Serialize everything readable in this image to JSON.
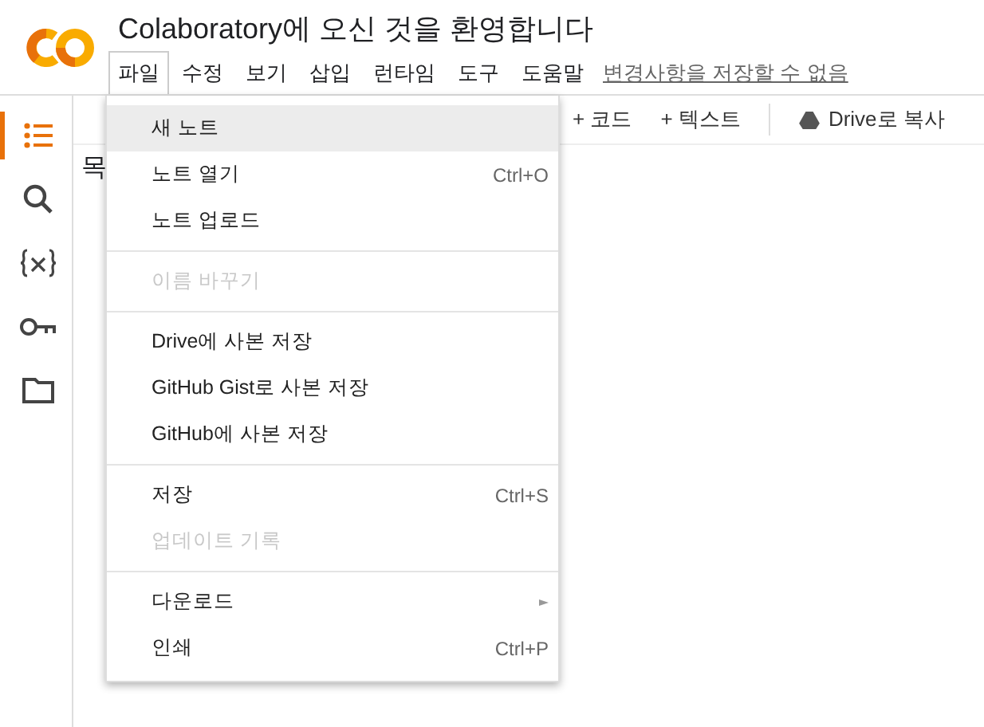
{
  "header": {
    "title": "Colaboratory에 오신 것을 환영합니다",
    "status_link": "변경사항을 저장할 수 없음"
  },
  "menubar": [
    {
      "label": "파일",
      "selected": true
    },
    {
      "label": "수정",
      "selected": false
    },
    {
      "label": "보기",
      "selected": false
    },
    {
      "label": "삽입",
      "selected": false
    },
    {
      "label": "런타임",
      "selected": false
    },
    {
      "label": "도구",
      "selected": false
    },
    {
      "label": "도움말",
      "selected": false
    }
  ],
  "sidebar": {
    "items": [
      {
        "kind": "toc",
        "selected": true
      },
      {
        "kind": "search",
        "selected": false
      },
      {
        "kind": "variables",
        "selected": false
      },
      {
        "kind": "secrets",
        "selected": false
      },
      {
        "kind": "files",
        "selected": false
      }
    ],
    "panel_title": "목"
  },
  "toolbar": {
    "add_code": "+ 코드",
    "add_text": "+ 텍스트",
    "copy_to_drive": "Drive로 복사"
  },
  "file_menu": {
    "sections": [
      [
        {
          "label": "새 노트",
          "disabled": false,
          "selected": true,
          "submenu": false
        },
        {
          "label": "노트 열기",
          "shortcut": "Ctrl+O",
          "disabled": false,
          "selected": false,
          "submenu": false
        },
        {
          "label": "노트 업로드",
          "disabled": false,
          "selected": false,
          "submenu": false
        }
      ],
      [
        {
          "label": "이름 바꾸기",
          "disabled": true,
          "selected": false,
          "submenu": false
        }
      ],
      [
        {
          "label": "Drive에 사본 저장",
          "disabled": false,
          "selected": false,
          "submenu": false
        },
        {
          "label": "GitHub Gist로 사본 저장",
          "disabled": false,
          "selected": false,
          "submenu": false
        },
        {
          "label": "GitHub에 사본 저장",
          "disabled": false,
          "selected": false,
          "submenu": false
        }
      ],
      [
        {
          "label": "저장",
          "shortcut": "Ctrl+S",
          "disabled": false,
          "selected": false,
          "submenu": false
        },
        {
          "label": "업데이트 기록",
          "disabled": true,
          "selected": false,
          "submenu": false
        }
      ],
      [
        {
          "label": "다운로드",
          "disabled": false,
          "selected": false,
          "submenu": true
        },
        {
          "label": "인쇄",
          "shortcut": "Ctrl+P",
          "disabled": false,
          "selected": false,
          "submenu": false
        }
      ]
    ]
  }
}
